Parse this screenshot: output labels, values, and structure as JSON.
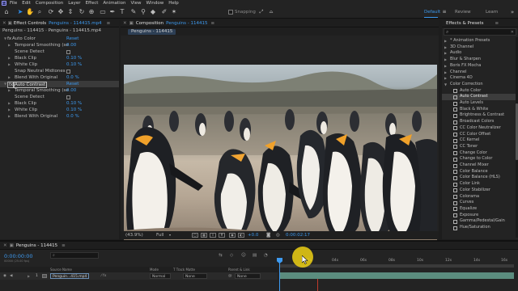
{
  "menubar": {
    "items": [
      "File",
      "Edit",
      "Composition",
      "Layer",
      "Effect",
      "Animation",
      "View",
      "Window",
      "Help"
    ]
  },
  "toolbar": {
    "snapping_label": "Snapping",
    "workspaces": [
      "Default",
      "Review",
      "Learn"
    ],
    "active_workspace": "Default"
  },
  "effect_controls": {
    "tab_label": "Effect Controls",
    "tab_file": "Penguins - 114415.mp4",
    "header": "Penguins - 114415 · Penguins - 114415.mp4",
    "effects": [
      {
        "name": "Auto Color",
        "reset": "Reset",
        "props": [
          {
            "name": "Temporal Smoothing (se",
            "value": "0.00"
          },
          {
            "name": "Scene Detect",
            "value": ""
          },
          {
            "name": "Black Clip",
            "value": "0.10 %"
          },
          {
            "name": "White Clip",
            "value": "0.10 %"
          },
          {
            "name": "Snap Neutral Midtones",
            "value": ""
          },
          {
            "name": "Blend With Original",
            "value": "0.0 %"
          }
        ]
      },
      {
        "name": "Auto Contrast",
        "reset": "Reset",
        "props": [
          {
            "name": "Temporal Smoothing (se",
            "value": "0.00"
          },
          {
            "name": "Scene Detect",
            "value": ""
          },
          {
            "name": "Black Clip",
            "value": "0.10 %"
          },
          {
            "name": "White Clip",
            "value": "0.10 %"
          },
          {
            "name": "Blend With Original",
            "value": "0.0 %"
          }
        ]
      }
    ]
  },
  "composition": {
    "tab_label": "Composition",
    "tab_name": "Penguins - 114415",
    "sub_tab": "Penguins - 114415",
    "zoom": "(43.9%)",
    "resolution": "Full",
    "timecode": "0:00:02:17",
    "exposure": "+0.0"
  },
  "effects_presets": {
    "tab_label": "Effects & Presets",
    "search_placeholder": "",
    "items": [
      {
        "label": "* Animation Presets",
        "level": 0
      },
      {
        "label": "3D Channel",
        "level": 0
      },
      {
        "label": "Audio",
        "level": 0
      },
      {
        "label": "Blur & Sharpen",
        "level": 0
      },
      {
        "label": "Boris FX Mocha",
        "level": 0
      },
      {
        "label": "Channel",
        "level": 0
      },
      {
        "label": "Cinema 4D",
        "level": 0
      },
      {
        "label": "Color Correction",
        "level": 0,
        "open": true
      },
      {
        "label": "Auto Color",
        "level": 1
      },
      {
        "label": "Auto Contrast",
        "level": 1,
        "selected": true
      },
      {
        "label": "Auto Levels",
        "level": 1
      },
      {
        "label": "Black & White",
        "level": 1
      },
      {
        "label": "Brightness & Contrast",
        "level": 1
      },
      {
        "label": "Broadcast Colors",
        "level": 1
      },
      {
        "label": "CC Color Neutralizer",
        "level": 1
      },
      {
        "label": "CC Color Offset",
        "level": 1
      },
      {
        "label": "CC Kernel",
        "level": 1
      },
      {
        "label": "CC Toner",
        "level": 1
      },
      {
        "label": "Change Color",
        "level": 1
      },
      {
        "label": "Change to Color",
        "level": 1
      },
      {
        "label": "Channel Mixer",
        "level": 1
      },
      {
        "label": "Color Balance",
        "level": 1
      },
      {
        "label": "Color Balance (HLS)",
        "level": 1
      },
      {
        "label": "Color Link",
        "level": 1
      },
      {
        "label": "Color Stabilizer",
        "level": 1
      },
      {
        "label": "Colorama",
        "level": 1
      },
      {
        "label": "Curves",
        "level": 1
      },
      {
        "label": "Equalize",
        "level": 1
      },
      {
        "label": "Exposure",
        "level": 1
      },
      {
        "label": "Gamma/Pedestal/Gain",
        "level": 1
      },
      {
        "label": "Hue/Saturation",
        "level": 1
      }
    ]
  },
  "timeline": {
    "tab_name": "Penguins - 114415",
    "current_time": "0:00:00:00",
    "frames": "00000 (25.00 fps)",
    "columns": {
      "source_name": "Source Name",
      "mode": "Mode",
      "trkmat": "T  Track Matte",
      "parent": "Parent & Link"
    },
    "layer": {
      "index": "1",
      "name": "Penguin...415.mp4",
      "mode": "Normal",
      "trkmat": "None",
      "parent": "None"
    },
    "ruler": [
      "0s",
      "02s",
      "04s",
      "06s",
      "08s",
      "10s",
      "12s",
      "14s",
      "16s"
    ]
  },
  "colors": {
    "accent": "#3d9af0",
    "panel": "#232323",
    "layer_bar": "#5b8c7e",
    "cursor_highlight": "#f5d714"
  }
}
